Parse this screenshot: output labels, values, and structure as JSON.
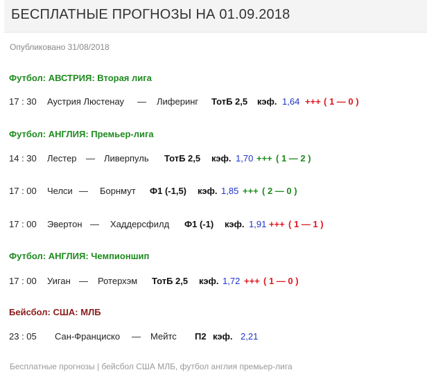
{
  "header": {
    "title_prefix": "БЕСПЛАТНЫЕ ПРОГНОЗЫ НА ",
    "title_date": "01.09.2018",
    "published": "Опубликовано 31/08/2018"
  },
  "colors": {
    "section_green": "#1e8a1e",
    "section_brown": "#8b1a1a",
    "odds_blue": "#1e32c8",
    "result_red": "#e0161b",
    "result_green": "#1e8a1e"
  },
  "sections": [
    {
      "title": "Футбол: АВСТРИЯ: Вторая лига",
      "matches": [
        {
          "time": "17 : 30",
          "home": "Аустрия Люстенау",
          "dash": "—",
          "away": "Лиферинг",
          "bet": "ТотБ  2,5",
          "coef_label": "кэф.",
          "odds": "1,64",
          "plus": "+++",
          "result": "( 1 — 0 )",
          "result_color": "red"
        }
      ]
    },
    {
      "title": "Футбол: АНГЛИЯ: Премьер-лига",
      "matches": [
        {
          "time": "14 : 30",
          "home": "Лестер",
          "dash": "—",
          "away": "Ливерпуль",
          "bet": "ТотБ  2,5",
          "coef_label": "кэф.",
          "odds": "1,70",
          "plus": "+++",
          "result": "( 1 — 2 )",
          "result_color": "green"
        },
        {
          "time": "17 : 00",
          "home": "Челси",
          "dash": "—",
          "away": "Борнмут",
          "bet": "Ф1 (-1,5)",
          "coef_label": "кэф.",
          "odds": "1,85",
          "plus": "+++",
          "result": "( 2 — 0 )",
          "result_color": "green"
        },
        {
          "time": "17 : 00",
          "home": "Эвертон",
          "dash": "—",
          "away": "Хаддерсфилд",
          "bet": "Ф1 (-1)",
          "coef_label": "кэф.",
          "odds": "1,91",
          "plus": "+++",
          "result": "( 1 — 1 )",
          "result_color": "red"
        }
      ]
    },
    {
      "title": "Футбол: АНГЛИЯ: Чемпионшип",
      "matches": [
        {
          "time": "17 : 00",
          "home": "Уиган",
          "dash": "—",
          "away": "Ротерхэм",
          "bet": "ТотБ  2,5",
          "coef_label": "кэф.",
          "odds": "1,72",
          "plus": "+++",
          "result": "( 1 — 0 )",
          "result_color": "red"
        }
      ]
    },
    {
      "title": "Бейсбол: США: МЛБ",
      "matches": [
        {
          "time": "23 : 05",
          "home": "Сан-Франциско",
          "dash": "—",
          "away": "Мейтс",
          "bet": "П2",
          "coef_label": "кэф.",
          "odds": "2,21",
          "plus": "",
          "result": "",
          "result_color": ""
        }
      ]
    }
  ],
  "footer": {
    "text": "Бесплатные прогнозы | бейсбол США МЛБ, футбол англия премьер-лига"
  }
}
